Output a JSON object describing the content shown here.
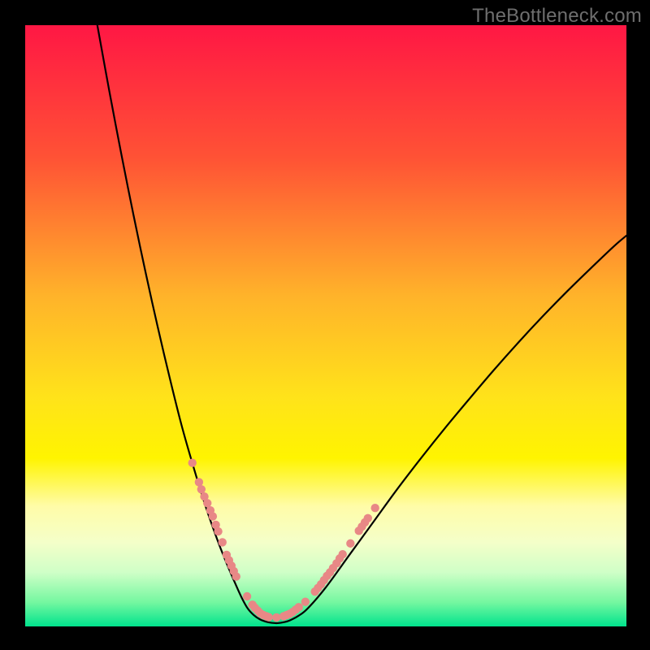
{
  "watermark": "TheBottleneck.com",
  "chart_data": {
    "type": "line",
    "title": "",
    "xlabel": "",
    "ylabel": "",
    "xlim": [
      0,
      100
    ],
    "ylim": [
      0,
      100
    ],
    "grid": false,
    "legend": false,
    "gradient_stops": [
      {
        "offset": 0.0,
        "color": "#ff1744"
      },
      {
        "offset": 0.22,
        "color": "#ff5235"
      },
      {
        "offset": 0.45,
        "color": "#ffb32a"
      },
      {
        "offset": 0.62,
        "color": "#ffe31a"
      },
      {
        "offset": 0.72,
        "color": "#fff400"
      },
      {
        "offset": 0.8,
        "color": "#fffca8"
      },
      {
        "offset": 0.86,
        "color": "#f4ffc9"
      },
      {
        "offset": 0.91,
        "color": "#cfffc7"
      },
      {
        "offset": 0.96,
        "color": "#74f7a0"
      },
      {
        "offset": 1.0,
        "color": "#00e38d"
      }
    ],
    "series": [
      {
        "name": "left-arm",
        "x": [
          12.0,
          14.0,
          16.0,
          18.0,
          20.0,
          22.0,
          24.0,
          26.0,
          28.0,
          30.0,
          32.0,
          33.5,
          35.0,
          36.0,
          37.0
        ],
        "y": [
          100.0,
          89.0,
          78.5,
          68.5,
          59.0,
          50.0,
          41.5,
          33.5,
          26.5,
          20.0,
          14.3,
          10.5,
          7.0,
          4.8,
          3.0
        ]
      },
      {
        "name": "valley",
        "x": [
          37.0,
          38.0,
          39.0,
          40.0,
          41.0,
          42.0,
          43.0,
          44.0,
          45.5,
          47.0
        ],
        "y": [
          3.0,
          1.9,
          1.2,
          0.8,
          0.6,
          0.55,
          0.7,
          1.0,
          1.8,
          3.0
        ]
      },
      {
        "name": "right-arm",
        "x": [
          47.0,
          50.0,
          54.0,
          58.0,
          62.0,
          66.0,
          70.0,
          74.0,
          78.0,
          82.0,
          86.0,
          90.0,
          94.0,
          98.0,
          100.0
        ],
        "y": [
          3.0,
          6.5,
          12.0,
          17.5,
          23.0,
          28.2,
          33.2,
          38.0,
          42.7,
          47.2,
          51.5,
          55.6,
          59.5,
          63.3,
          65.0
        ]
      }
    ],
    "marker_clusters": {
      "comment": "Salmon dotted segments on the curve near the valley",
      "color": "#e88886",
      "points_xy": [
        [
          27.8,
          27.2
        ],
        [
          28.9,
          24.0
        ],
        [
          29.3,
          22.8
        ],
        [
          29.8,
          21.6
        ],
        [
          30.3,
          20.5
        ],
        [
          30.8,
          19.3
        ],
        [
          31.2,
          18.3
        ],
        [
          31.7,
          16.9
        ],
        [
          32.1,
          15.8
        ],
        [
          32.8,
          14.0
        ],
        [
          33.5,
          11.9
        ],
        [
          33.9,
          11.0
        ],
        [
          34.3,
          10.1
        ],
        [
          34.7,
          9.2
        ],
        [
          35.1,
          8.3
        ],
        [
          36.9,
          5.0
        ],
        [
          37.8,
          3.6
        ],
        [
          38.2,
          3.1
        ],
        [
          38.7,
          2.6
        ],
        [
          39.1,
          2.2
        ],
        [
          39.6,
          1.9
        ],
        [
          40.1,
          1.7
        ],
        [
          40.5,
          1.55
        ],
        [
          41.8,
          1.5
        ],
        [
          43.0,
          1.7
        ],
        [
          43.5,
          1.9
        ],
        [
          44.0,
          2.1
        ],
        [
          44.5,
          2.4
        ],
        [
          45.0,
          2.8
        ],
        [
          45.5,
          3.2
        ],
        [
          46.6,
          4.1
        ],
        [
          48.2,
          5.8
        ],
        [
          48.7,
          6.4
        ],
        [
          49.2,
          7.0
        ],
        [
          49.7,
          7.7
        ],
        [
          50.2,
          8.4
        ],
        [
          50.7,
          9.0
        ],
        [
          51.2,
          9.7
        ],
        [
          51.8,
          10.5
        ],
        [
          52.3,
          11.3
        ],
        [
          52.8,
          12.0
        ],
        [
          54.1,
          13.8
        ],
        [
          55.5,
          15.9
        ],
        [
          56.0,
          16.6
        ],
        [
          56.5,
          17.3
        ],
        [
          57.0,
          18.0
        ],
        [
          58.2,
          19.7
        ]
      ]
    }
  }
}
